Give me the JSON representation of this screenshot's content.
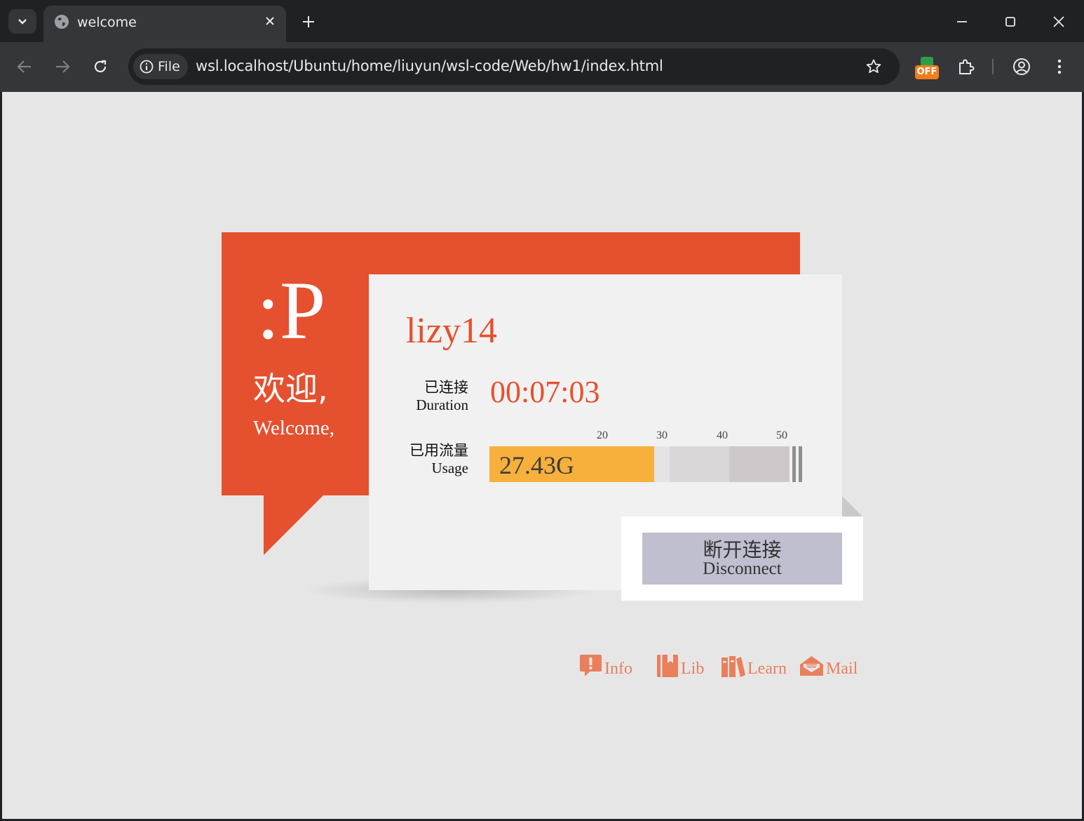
{
  "browser": {
    "tab_title": "welcome",
    "site_chip": "File",
    "url": "wsl.localhost/Ubuntu/home/liuyun/wsl-code/Web/hw1/index.html",
    "extension_badge": "OFF"
  },
  "card": {
    "logo": ":P",
    "welcome_cn": "欢迎,",
    "welcome_en": "Welcome,",
    "username": "lizy14",
    "duration_label_cn": "已连接",
    "duration_label_en": "Duration",
    "duration_value": "00:07:03",
    "usage_label_cn": "已用流量",
    "usage_label_en": "Usage",
    "usage_value": "27.43G",
    "usage_ticks": [
      "20",
      "30",
      "40",
      "50"
    ],
    "usage_fill_fraction": 0.5486,
    "disconnect_cn": "断开连接",
    "disconnect_en": "Disconnect"
  },
  "links": [
    {
      "label": "Info",
      "icon": "exclamation-icon"
    },
    {
      "label": "Lib",
      "icon": "book-icon"
    },
    {
      "label": "Learn",
      "icon": "books-icon"
    },
    {
      "label": "Mail",
      "icon": "mail-open-icon"
    }
  ],
  "colors": {
    "brand_red": "#e5502f",
    "usage_fill": "#f8b03c",
    "link": "#ea7f5c",
    "button": "#c0bfcf"
  }
}
